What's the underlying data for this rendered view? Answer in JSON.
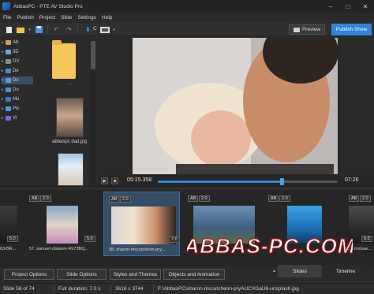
{
  "window": {
    "title": "AbbasPC - PTE AV Studio Pro",
    "minimize": "–",
    "maximize": "□",
    "close": "✕"
  },
  "menu": [
    "File",
    "Publish",
    "Project",
    "Slide",
    "Settings",
    "Help"
  ],
  "toolbar": {
    "add_label": "C",
    "preview_label": "Preview",
    "publish_label": "Publish Show",
    "icons": [
      "new-project-icon",
      "open-folder-icon",
      "save-icon",
      "undo-icon",
      "redo-icon",
      "add-slide-icon",
      "slide-options-icon",
      "preview-icon"
    ]
  },
  "tree": [
    {
      "label": "Ab",
      "icon_color": "#c9a15a"
    },
    {
      "label": "3D",
      "icon_color": "#6aa6e8"
    },
    {
      "label": "DV",
      "icon_color": "#8a8a8a"
    },
    {
      "label": "De",
      "icon_color": "#4a8ad6"
    },
    {
      "label": "Do",
      "icon_color": "#5a9be0",
      "selected": true
    },
    {
      "label": "Do",
      "icon_color": "#4a90d9"
    },
    {
      "label": "Mu",
      "icon_color": "#3a7bd5"
    },
    {
      "label": "Pic",
      "icon_color": "#3aa0d9"
    },
    {
      "label": "Vi",
      "icon_color": "#7a6ad9"
    }
  ],
  "files": {
    "folder_caption": "..",
    "file1_caption": "abbaspc dad.jpg"
  },
  "player": {
    "current_time": "05:15.358",
    "total_time": "07:26",
    "progress": 0.69,
    "play_label": "▶",
    "stop_label": "■"
  },
  "slides": [
    {
      "caption": "63rBR...",
      "ab": "AB",
      "dur": "2.0",
      "dur2": "5.0"
    },
    {
      "caption": "57. samuel-zlatarev-Rx73BQ...",
      "ab": "AB",
      "dur": "2.0",
      "dur2": "5.0"
    },
    {
      "caption": "58. sharon-mccutcheon-pry...",
      "ab": "AB",
      "dur": "2.0",
      "dur2": "7.0",
      "selected": true
    },
    {
      "caption": "59...",
      "ab": "AB",
      "dur": "2.0",
      "dur2": ""
    },
    {
      "caption": "...",
      "ab": "AB",
      "dur": "2.0",
      "dur2": ""
    },
    {
      "caption": "11. mickae...",
      "ab": "AB",
      "dur": "2.0",
      "dur2": "5.0"
    }
  ],
  "watermark": "ABBAS-PC.COM",
  "buttons": {
    "project_options": "Project Options",
    "slide_options": "Slide Options",
    "styles_themes": "Styles and Themes",
    "objects_animation": "Objects and Animation"
  },
  "tabs": {
    "slides": "Slides",
    "timeline": "Timeline"
  },
  "status": {
    "slide_count": "Slide 58 of 74",
    "full_duration": "Full duration: 7.0 s",
    "dimensions": "3616 x 3744",
    "path": "F:\\AbbasPC\\sharon-mccutcheon-pryAUCXGaU8-unsplash.jpg"
  },
  "colors": {
    "accent": "#2f85d8",
    "background": "#2d2d2d",
    "selected_slide": "#364d66"
  }
}
